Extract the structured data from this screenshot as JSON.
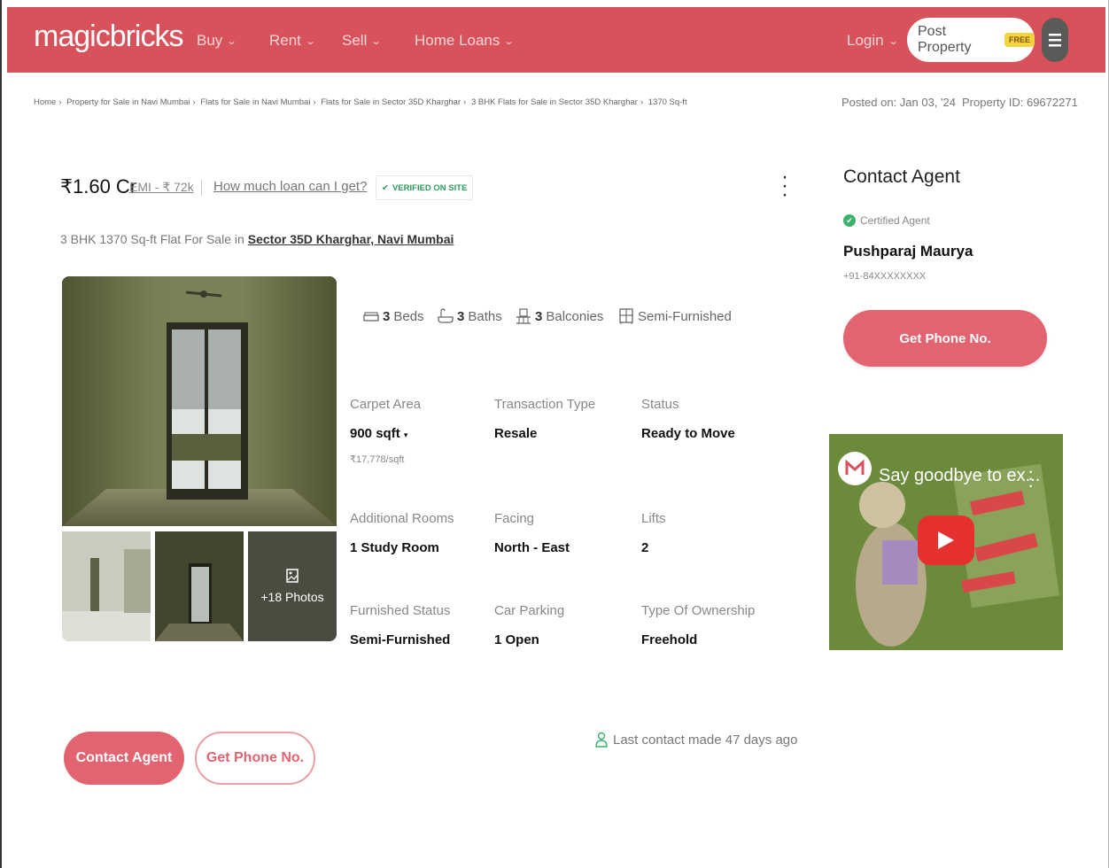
{
  "header": {
    "logo": "magicbricks",
    "nav": [
      {
        "label": "Buy"
      },
      {
        "label": "Rent"
      },
      {
        "label": "Sell"
      },
      {
        "label": "Home Loans"
      }
    ],
    "login": "Login",
    "post_property": "Post Property",
    "free_badge": "FREE"
  },
  "breadcrumb": [
    "Home",
    "Property for Sale in Navi Mumbai",
    "Flats for Sale in Navi Mumbai",
    "Flats for Sale in Sector 35D Kharghar",
    "3 BHK Flats for Sale in Sector 35D Kharghar",
    "1370 Sq-ft"
  ],
  "meta": {
    "posted_on": "Posted on: Jan 03, '24",
    "property_id": "Property ID: 69672271"
  },
  "listing": {
    "price": "₹1.60 Cr",
    "emi": "EMI - ₹ 72k",
    "loan_link": "How much loan can I get?",
    "verified": "VERIFIED ON SITE",
    "subtitle_prefix": "3 BHK 1370 Sq-ft Flat For Sale in",
    "location": "Sector 35D Kharghar, Navi Mumbai",
    "more_photos": "+18 Photos"
  },
  "amenities": [
    {
      "count": "3",
      "label": "Beds",
      "icon": "bed-icon"
    },
    {
      "count": "3",
      "label": "Baths",
      "icon": "bath-icon"
    },
    {
      "count": "3",
      "label": "Balconies",
      "icon": "balcony-icon"
    },
    {
      "count": "",
      "label": "Semi-Furnished",
      "icon": "furniture-icon"
    }
  ],
  "details": [
    {
      "label": "Carpet Area",
      "value": "900 sqft",
      "sub": "₹17,778/sqft"
    },
    {
      "label": "Transaction Type",
      "value": "Resale"
    },
    {
      "label": "Status",
      "value": "Ready to Move"
    },
    {
      "label": "Additional Rooms",
      "value": "1 Study Room"
    },
    {
      "label": "Facing",
      "value": "North - East"
    },
    {
      "label": "Lifts",
      "value": "2"
    },
    {
      "label": "Furnished Status",
      "value": "Semi-Furnished"
    },
    {
      "label": "Car Parking",
      "value": "1 Open"
    },
    {
      "label": "Type Of Ownership",
      "value": "Freehold"
    }
  ],
  "agent": {
    "title": "Contact Agent",
    "certified": "Certified Agent",
    "name": "Pushparaj Maurya",
    "phone": "+91-84XXXXXXXX",
    "get_phone": "Get Phone No."
  },
  "video": {
    "title": "Say goodbye to ex...",
    "channel_badge": "MB TV"
  },
  "bottom": {
    "contact_agent": "Contact Agent",
    "get_phone": "Get Phone No.",
    "last_contact": "Last contact made 47 days ago"
  },
  "colors": {
    "brand": "#d8525b",
    "button": "#e16470",
    "verified": "#2a9d5b"
  }
}
